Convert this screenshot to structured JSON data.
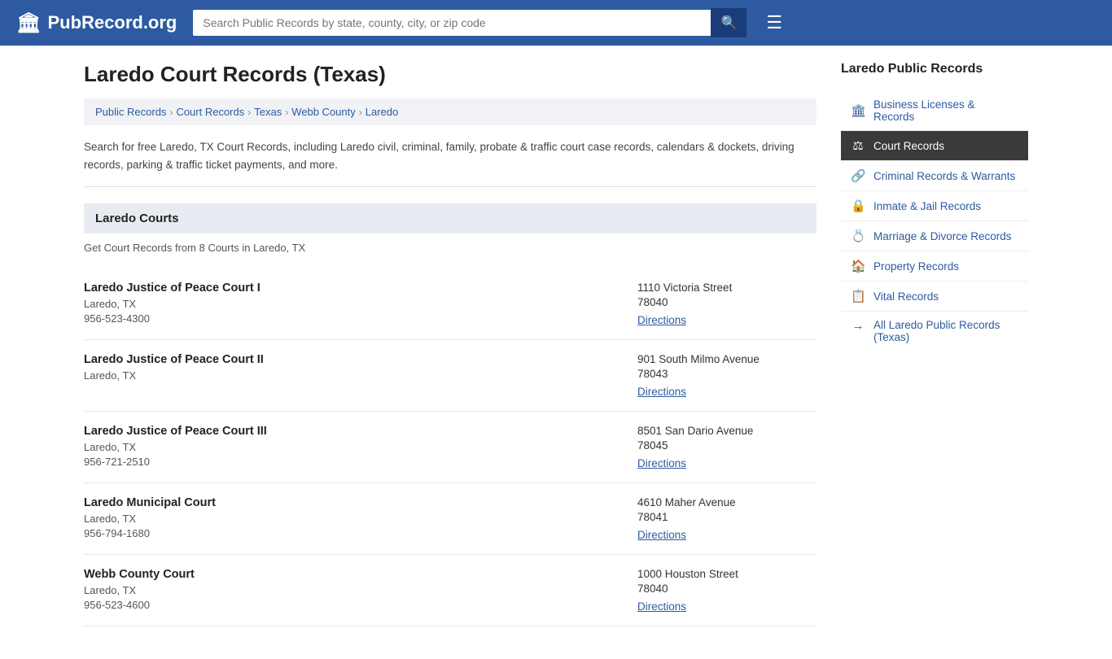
{
  "header": {
    "logo_text": "PubRecord.org",
    "logo_icon": "🏛",
    "search_placeholder": "Search Public Records by state, county, city, or zip code",
    "search_icon": "🔍",
    "menu_icon": "☰"
  },
  "page": {
    "title": "Laredo Court Records (Texas)",
    "breadcrumb": [
      {
        "label": "Public Records",
        "href": "#"
      },
      {
        "label": "Court Records",
        "href": "#"
      },
      {
        "label": "Texas",
        "href": "#"
      },
      {
        "label": "Webb County",
        "href": "#"
      },
      {
        "label": "Laredo",
        "href": "#"
      }
    ],
    "description": "Search for free Laredo, TX Court Records, including Laredo civil, criminal, family, probate & traffic court case records, calendars & dockets, driving records, parking & traffic ticket payments, and more.",
    "section_title": "Laredo Courts",
    "section_subtext": "Get Court Records from 8 Courts in Laredo, TX",
    "courts": [
      {
        "name": "Laredo Justice of Peace Court I",
        "city": "Laredo, TX",
        "phone": "956-523-4300",
        "address": "1110 Victoria Street",
        "zip": "78040",
        "directions_label": "Directions"
      },
      {
        "name": "Laredo Justice of Peace Court II",
        "city": "Laredo, TX",
        "phone": "",
        "address": "901 South Milmo Avenue",
        "zip": "78043",
        "directions_label": "Directions"
      },
      {
        "name": "Laredo Justice of Peace Court III",
        "city": "Laredo, TX",
        "phone": "956-721-2510",
        "address": "8501 San Dario Avenue",
        "zip": "78045",
        "directions_label": "Directions"
      },
      {
        "name": "Laredo Municipal Court",
        "city": "Laredo, TX",
        "phone": "956-794-1680",
        "address": "4610 Maher Avenue",
        "zip": "78041",
        "directions_label": "Directions"
      },
      {
        "name": "Webb County Court",
        "city": "Laredo, TX",
        "phone": "956-523-4600",
        "address": "1000 Houston Street",
        "zip": "78040",
        "directions_label": "Directions"
      }
    ]
  },
  "sidebar": {
    "title": "Laredo Public Records",
    "items": [
      {
        "label": "Business Licenses & Records",
        "icon": "🏛",
        "active": false
      },
      {
        "label": "Court Records",
        "icon": "⚖",
        "active": true
      },
      {
        "label": "Criminal Records & Warrants",
        "icon": "🔗",
        "active": false
      },
      {
        "label": "Inmate & Jail Records",
        "icon": "🔒",
        "active": false
      },
      {
        "label": "Marriage & Divorce Records",
        "icon": "💍",
        "active": false
      },
      {
        "label": "Property Records",
        "icon": "🏠",
        "active": false
      },
      {
        "label": "Vital Records",
        "icon": "📋",
        "active": false
      }
    ],
    "all_label": "All Laredo Public Records (Texas)",
    "all_icon": "→"
  }
}
